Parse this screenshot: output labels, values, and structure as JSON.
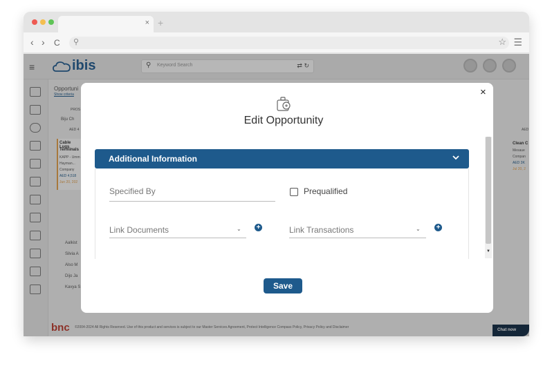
{
  "browser": {
    "tab_close": "×",
    "tab_new": "+",
    "nav_back": "‹",
    "nav_forward": "›",
    "nav_reload": "C",
    "search_icon": "⚲",
    "star_icon": "☆",
    "menu_icon": "☰",
    "traffic_colors": [
      "#ee5a52",
      "#f4be4f",
      "#5fc456"
    ]
  },
  "app": {
    "logo": "ibis",
    "menu_icon": "≡",
    "search": {
      "placeholder": "Keyword Search",
      "icon": "⚲",
      "tools": "⇄ ↻"
    },
    "background_texts": {
      "heading": "Opportuni",
      "show_criteria": "Show criteria",
      "col_header": "PROS",
      "group": "Biju Ch",
      "amount": "AED 4",
      "card_title": "Cable Lugs",
      "card_sub": "Terminals",
      "card_line1": "KAPP - Umm",
      "card_line2": "Hayman...",
      "card_line3": "Company",
      "card_line4": "AED 4,518",
      "card_line5": "Jun 20, 202",
      "right_title": "Clean C",
      "right_amount": "AED",
      "right_line1": "Mesaue",
      "right_line2": "Compan",
      "right_line3": "AED 3K",
      "right_line4": "Jul 20, 2",
      "list_items": [
        "Aalkist",
        "Silvia A",
        "Also M",
        "Dijo Ja",
        "Kavya S"
      ]
    },
    "footer": {
      "brand": "bnc",
      "legal": "©2004-2024 All Rights Reserved. Use of this product and services is subject to our Master Services Agreement, Protect Intelligence Compass Policy, Privacy Policy and Disclaimer",
      "chat": "Chat now"
    }
  },
  "modal": {
    "title": "Edit Opportunity",
    "close": "×",
    "section_title": "Additional Information",
    "fields": {
      "specified_by": "Specified By",
      "prequalified": "Prequalified",
      "link_documents": "Link Documents",
      "link_transactions": "Link Transactions"
    },
    "plus_label": "+",
    "caret": "⌄",
    "scroll_down": "▼",
    "save_label": "Save"
  },
  "colors": {
    "primary": "#1e5a8c",
    "overlay": "rgba(30,30,30,0.32)",
    "footer_brand": "#c0392b"
  }
}
